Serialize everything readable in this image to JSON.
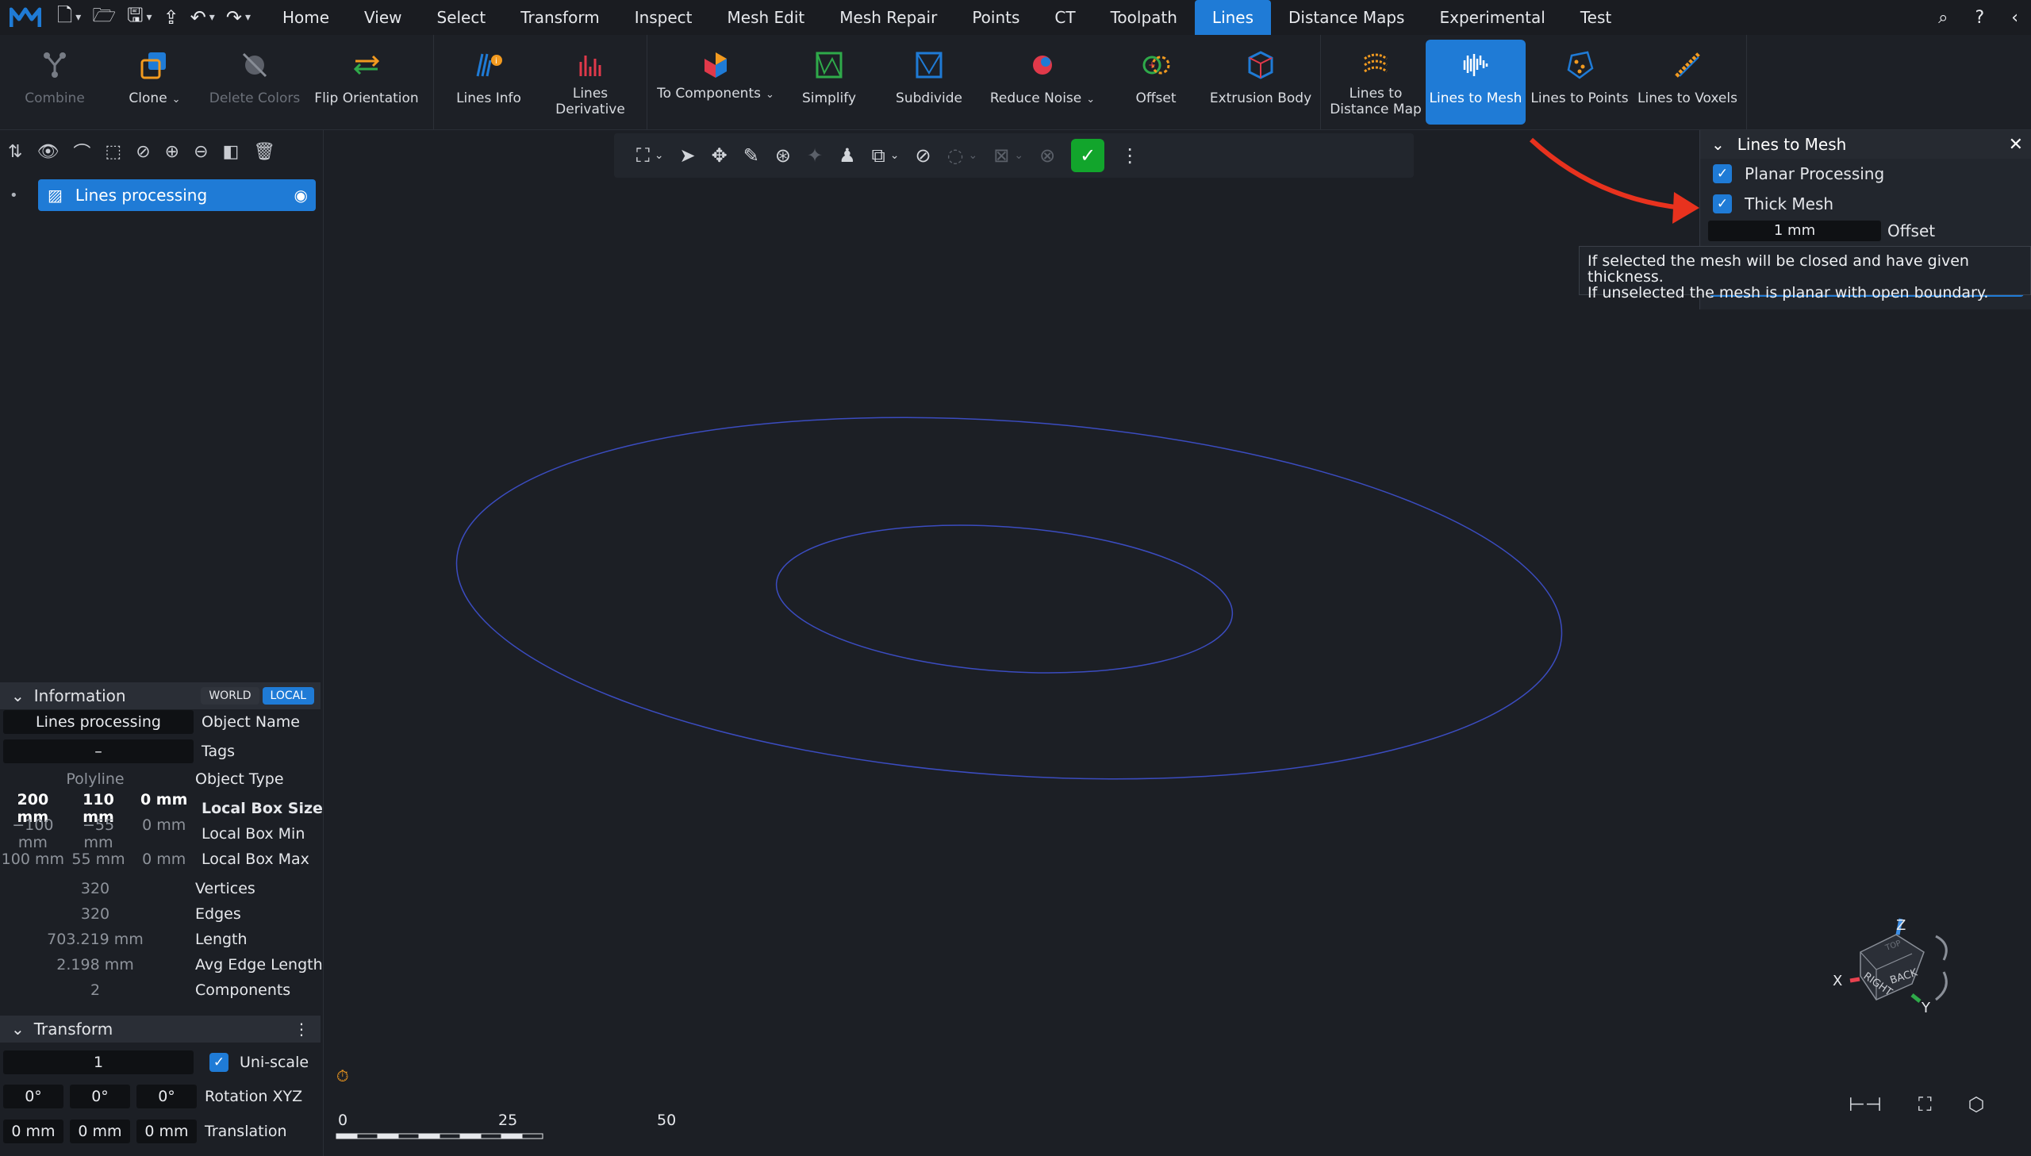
{
  "menu": {
    "tabs": [
      "Home",
      "View",
      "Select",
      "Transform",
      "Inspect",
      "Mesh Edit",
      "Mesh Repair",
      "Points",
      "CT",
      "Toolpath",
      "Lines",
      "Distance Maps",
      "Experimental",
      "Test"
    ],
    "active_tab": "Lines"
  },
  "ribbon": {
    "combine": "Combine",
    "clone": "Clone",
    "delete_colors": "Delete Colors",
    "flip_orientation": "Flip Orientation",
    "lines_info": "Lines Info",
    "lines_derivative": "Lines Derivative",
    "to_components": "To Components",
    "simplify": "Simplify",
    "subdivide": "Subdivide",
    "reduce_noise": "Reduce Noise",
    "offset": "Offset",
    "extrusion_body": "Extrusion Body",
    "lines_to_distance_map": "Lines to Distance Map",
    "lines_to_mesh": "Lines to Mesh",
    "lines_to_points": "Lines to Points",
    "lines_to_voxels": "Lines to Voxels"
  },
  "scene": {
    "object_name": "Lines processing"
  },
  "information": {
    "title": "Information",
    "world": "WORLD",
    "local": "LOCAL",
    "object_name_value": "Lines processing",
    "object_name_label": "Object Name",
    "tags_value": "–",
    "tags_label": "Tags",
    "object_type_value": "Polyline",
    "object_type_label": "Object Type",
    "box_size": [
      "200 mm",
      "110 mm",
      "0 mm"
    ],
    "box_size_label": "Local Box Size",
    "box_min": [
      "−100 mm",
      "−55 mm",
      "0 mm"
    ],
    "box_min_label": "Local Box Min",
    "box_max": [
      "100 mm",
      "55 mm",
      "0 mm"
    ],
    "box_max_label": "Local Box Max",
    "vertices_value": "320",
    "vertices_label": "Vertices",
    "edges_value": "320",
    "edges_label": "Edges",
    "length_value": "703.219 mm",
    "length_label": "Length",
    "avg_edge_value": "2.198 mm",
    "avg_edge_label": "Avg Edge Length",
    "components_value": "2",
    "components_label": "Components"
  },
  "transform": {
    "title": "Transform",
    "scale_value": "1",
    "uniscale_label": "Uni-scale",
    "rotation": [
      "0°",
      "0°",
      "0°"
    ],
    "rotation_label": "Rotation XYZ",
    "translation": [
      "0 mm",
      "0 mm",
      "0 mm"
    ],
    "translation_label": "Translation"
  },
  "dialog": {
    "title": "Lines to Mesh",
    "planar_processing": "Planar Processing",
    "thick_mesh": "Thick Mesh",
    "offset_value": "1 mm",
    "offset_label": "Offset"
  },
  "tooltip": {
    "line1": "If selected the mesh will be closed and have given thickness.",
    "line2": "If unselected the mesh is planar with open boundary."
  },
  "gizmo": {
    "x": "X",
    "y": "Y",
    "z": "Z",
    "right": "RIGHT",
    "back": "BACK",
    "top": "TOP"
  },
  "scale_bar": {
    "labels": [
      "0",
      "25",
      "50"
    ]
  },
  "colors": {
    "accent": "#1f7bd6",
    "ok": "#12a52c",
    "curve": "#3b4cc0",
    "arrow": "#e8321e"
  }
}
